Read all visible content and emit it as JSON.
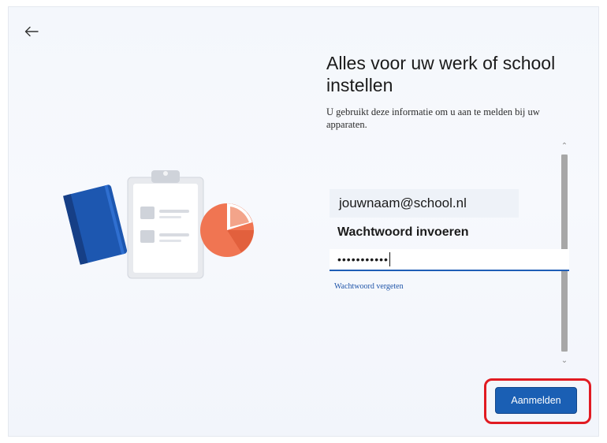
{
  "header": {
    "back_icon": "arrow-left-icon"
  },
  "main": {
    "title": "Alles voor uw werk of school instellen",
    "description": "U gebruikt deze informatie om u aan te melden bij uw apparaten.",
    "email_value": "jouwnaam@school.nl",
    "password_label": "Wachtwoord invoeren",
    "password_mask": "•••••••••••",
    "forgot_link": "Wachtwoord vergeten",
    "signin_label": "Aanmelden"
  },
  "scrollbar": {
    "up_icon": "chevron-up-icon",
    "down_icon": "chevron-down-icon",
    "up_glyph": "⌃",
    "down_glyph": "⌄"
  },
  "colors": {
    "accent": "#1a5fb4",
    "highlight": "#e11b22",
    "link": "#1f55a8"
  }
}
